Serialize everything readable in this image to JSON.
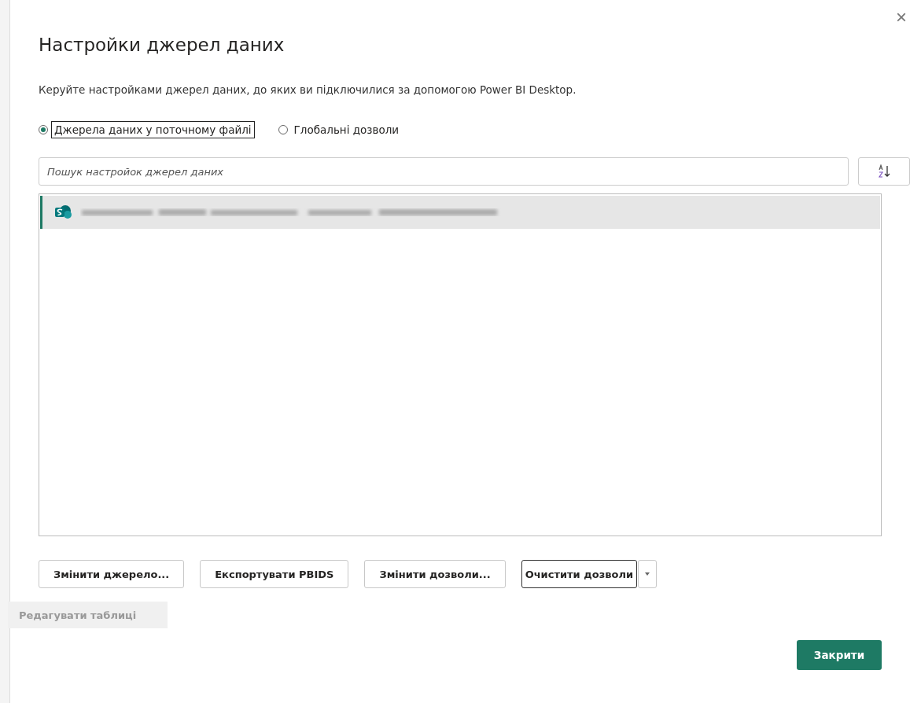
{
  "dialog": {
    "title": "Настройки джерел даних",
    "close": "×",
    "description": "Керуйте настройками джерел даних, до яких ви підключилися за допомогою Power BI Desktop."
  },
  "scope_options": [
    {
      "label": "Джерела даних у поточному файлі",
      "selected": true
    },
    {
      "label": "Глобальні дозволи",
      "selected": false
    }
  ],
  "search": {
    "placeholder": "Пошук настройок джерел даних"
  },
  "sources": [
    {
      "kind": "sharepoint",
      "selected": true
    }
  ],
  "buttons": [
    {
      "label": "Змінити джерело...",
      "kind": "plain"
    },
    {
      "label": "Експортувати PBIDS",
      "kind": "plain"
    },
    {
      "label": "Змінити дозволи...",
      "kind": "plain"
    },
    {
      "label": "Очистити дозволи",
      "kind": "split"
    }
  ],
  "tooltip": {
    "text": "Редагувати таблиці"
  },
  "footer": {
    "close_button": "Закрити"
  }
}
